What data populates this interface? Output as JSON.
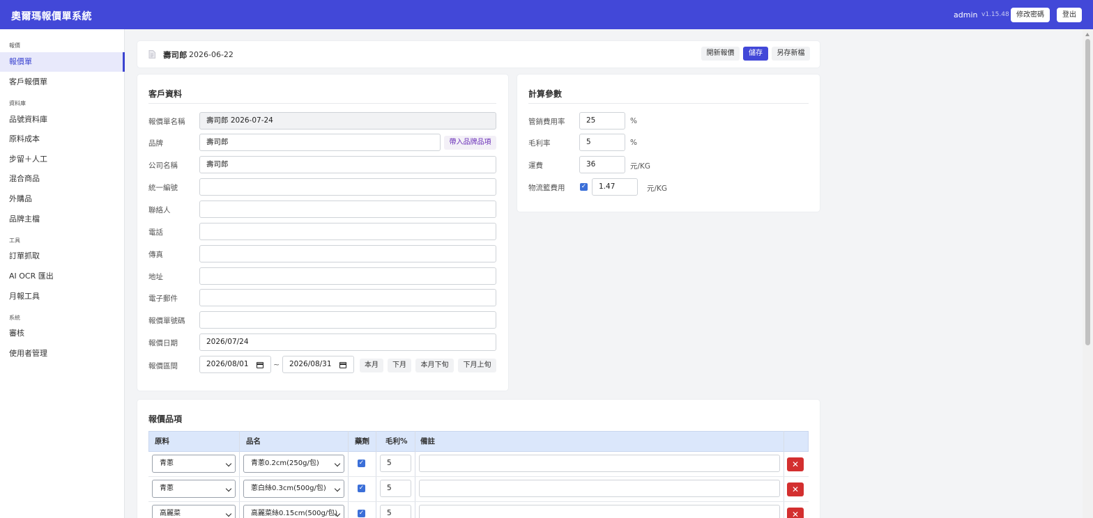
{
  "header": {
    "title": "奧爾瑪報價單系統",
    "user": "admin",
    "version": "v1.15.48",
    "change_password": "修改密碼",
    "logout": "登出"
  },
  "sidebar": {
    "sections": [
      {
        "title": "報價",
        "items": [
          {
            "label": "報價單",
            "active": true
          },
          {
            "label": "客戶報價單"
          }
        ]
      },
      {
        "title": "資料庫",
        "items": [
          {
            "label": "品號資料庫"
          },
          {
            "label": "原料成本"
          },
          {
            "label": "步留＋人工"
          },
          {
            "label": "混合商品"
          },
          {
            "label": "外購品"
          },
          {
            "label": "品牌主檔"
          }
        ]
      },
      {
        "title": "工具",
        "items": [
          {
            "label": "訂單抓取"
          },
          {
            "label": "AI OCR 匯出"
          },
          {
            "label": "月報工具"
          }
        ]
      },
      {
        "title": "系統",
        "items": [
          {
            "label": "審核"
          },
          {
            "label": "使用者管理"
          }
        ]
      }
    ]
  },
  "quote_header": {
    "title": "壽司郎",
    "date": "2026-06-22",
    "new_quote": "開新報價",
    "save": "儲存",
    "save_as": "另存新檔"
  },
  "customer": {
    "title": "客戶資料",
    "fields": {
      "quote_name": {
        "label": "報價單名稱",
        "value": "壽司郎 2026-07-24"
      },
      "brand": {
        "label": "品牌",
        "value": "壽司郎",
        "button": "帶入品牌品項"
      },
      "company": {
        "label": "公司名稱",
        "value": "壽司郎"
      },
      "tax_id": {
        "label": "統一編號",
        "value": ""
      },
      "contact": {
        "label": "聯絡人",
        "value": ""
      },
      "phone": {
        "label": "電話",
        "value": ""
      },
      "fax": {
        "label": "傳真",
        "value": ""
      },
      "address": {
        "label": "地址",
        "value": ""
      },
      "email": {
        "label": "電子郵件",
        "value": ""
      },
      "quote_number": {
        "label": "報價單號碼",
        "value": ""
      },
      "quote_date": {
        "label": "報價日期",
        "value": "2026/07/24"
      },
      "period": {
        "label": "報價區間",
        "start": "2026/08/01",
        "end": "2026/08/31",
        "separator": "~",
        "buttons": [
          "本月",
          "下月",
          "本月下旬",
          "下月上旬"
        ]
      }
    }
  },
  "params": {
    "title": "計算參數",
    "mgmt_rate": {
      "label": "管銷費用率",
      "value": "25",
      "unit": "%"
    },
    "gross_margin": {
      "label": "毛利率",
      "value": "5",
      "unit": "%"
    },
    "freight": {
      "label": "運費",
      "value": "36",
      "unit": "元/KG"
    },
    "crate_fee": {
      "label": "物流籃費用",
      "value": "1.47",
      "unit": "元/KG",
      "checked": true
    }
  },
  "items": {
    "title": "報價品項",
    "columns": [
      "原料",
      "品名",
      "藥劑",
      "毛利%",
      "備註"
    ],
    "rows": [
      {
        "material": "青蔥",
        "product": "青蔥0.2cm(250g/包)",
        "agent": true,
        "margin": "5",
        "note": ""
      },
      {
        "material": "青蔥",
        "product": "蔥白絲0.3cm(500g/包)",
        "agent": true,
        "margin": "5",
        "note": ""
      },
      {
        "material": "高麗菜",
        "product": "高麗菜絲0.15cm(500g/包)",
        "agent": true,
        "margin": "5",
        "note": ""
      }
    ],
    "delete_symbol": "✕"
  },
  "colors": {
    "brand": "#4248d8",
    "active_nav_bg": "#e8e9fb",
    "delete": "#d32f2f",
    "table_head": "#dbe7fb"
  }
}
